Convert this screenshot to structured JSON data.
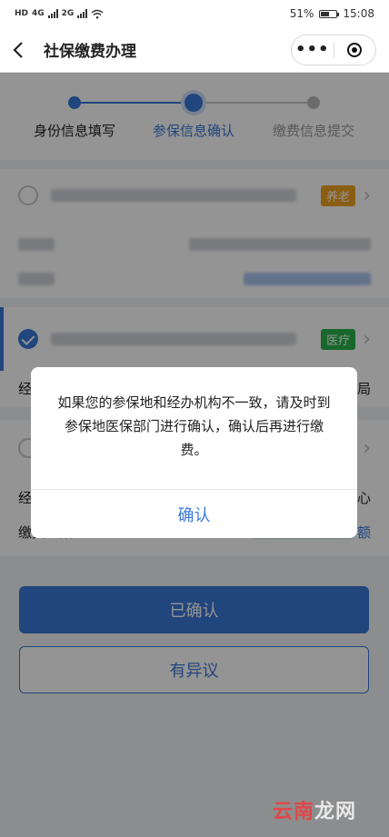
{
  "status_bar": {
    "net_a": "HD",
    "net_b": "4G",
    "net_c": "2G",
    "battery": "51%",
    "time": "15:08"
  },
  "nav": {
    "title": "社保缴费办理",
    "more_icon": "more-dots-icon",
    "close_icon": "target-close-icon"
  },
  "stepper": {
    "steps": [
      {
        "label": "身份信息填写",
        "state": "done"
      },
      {
        "label": "参保信息确认",
        "state": "current"
      },
      {
        "label": "缴费信息提交",
        "state": "todo"
      }
    ],
    "colors": {
      "active": "#3a78d8",
      "inactive": "#bbbbbb"
    }
  },
  "cards": [
    {
      "tag": "养老",
      "tag_color": "#f0a020",
      "checked": false
    },
    {
      "tag": "医疗",
      "tag_color": "#2ab24a",
      "checked": true,
      "row_left": "经",
      "row_right": "局"
    },
    {
      "checked": false,
      "row2_left": "经",
      "row2_right": "心",
      "row3_left": "缴费基数",
      "row3_right": "额"
    }
  ],
  "buttons": {
    "confirmed": "已确认",
    "objection": "有异议"
  },
  "dialog": {
    "message": "如果您的参保地和经办机构不一致，请及时到参保地医保部门进行确认，确认后再进行缴费。",
    "confirm": "确认"
  },
  "watermark": {
    "part1": "云南",
    "part2": "龙网"
  }
}
